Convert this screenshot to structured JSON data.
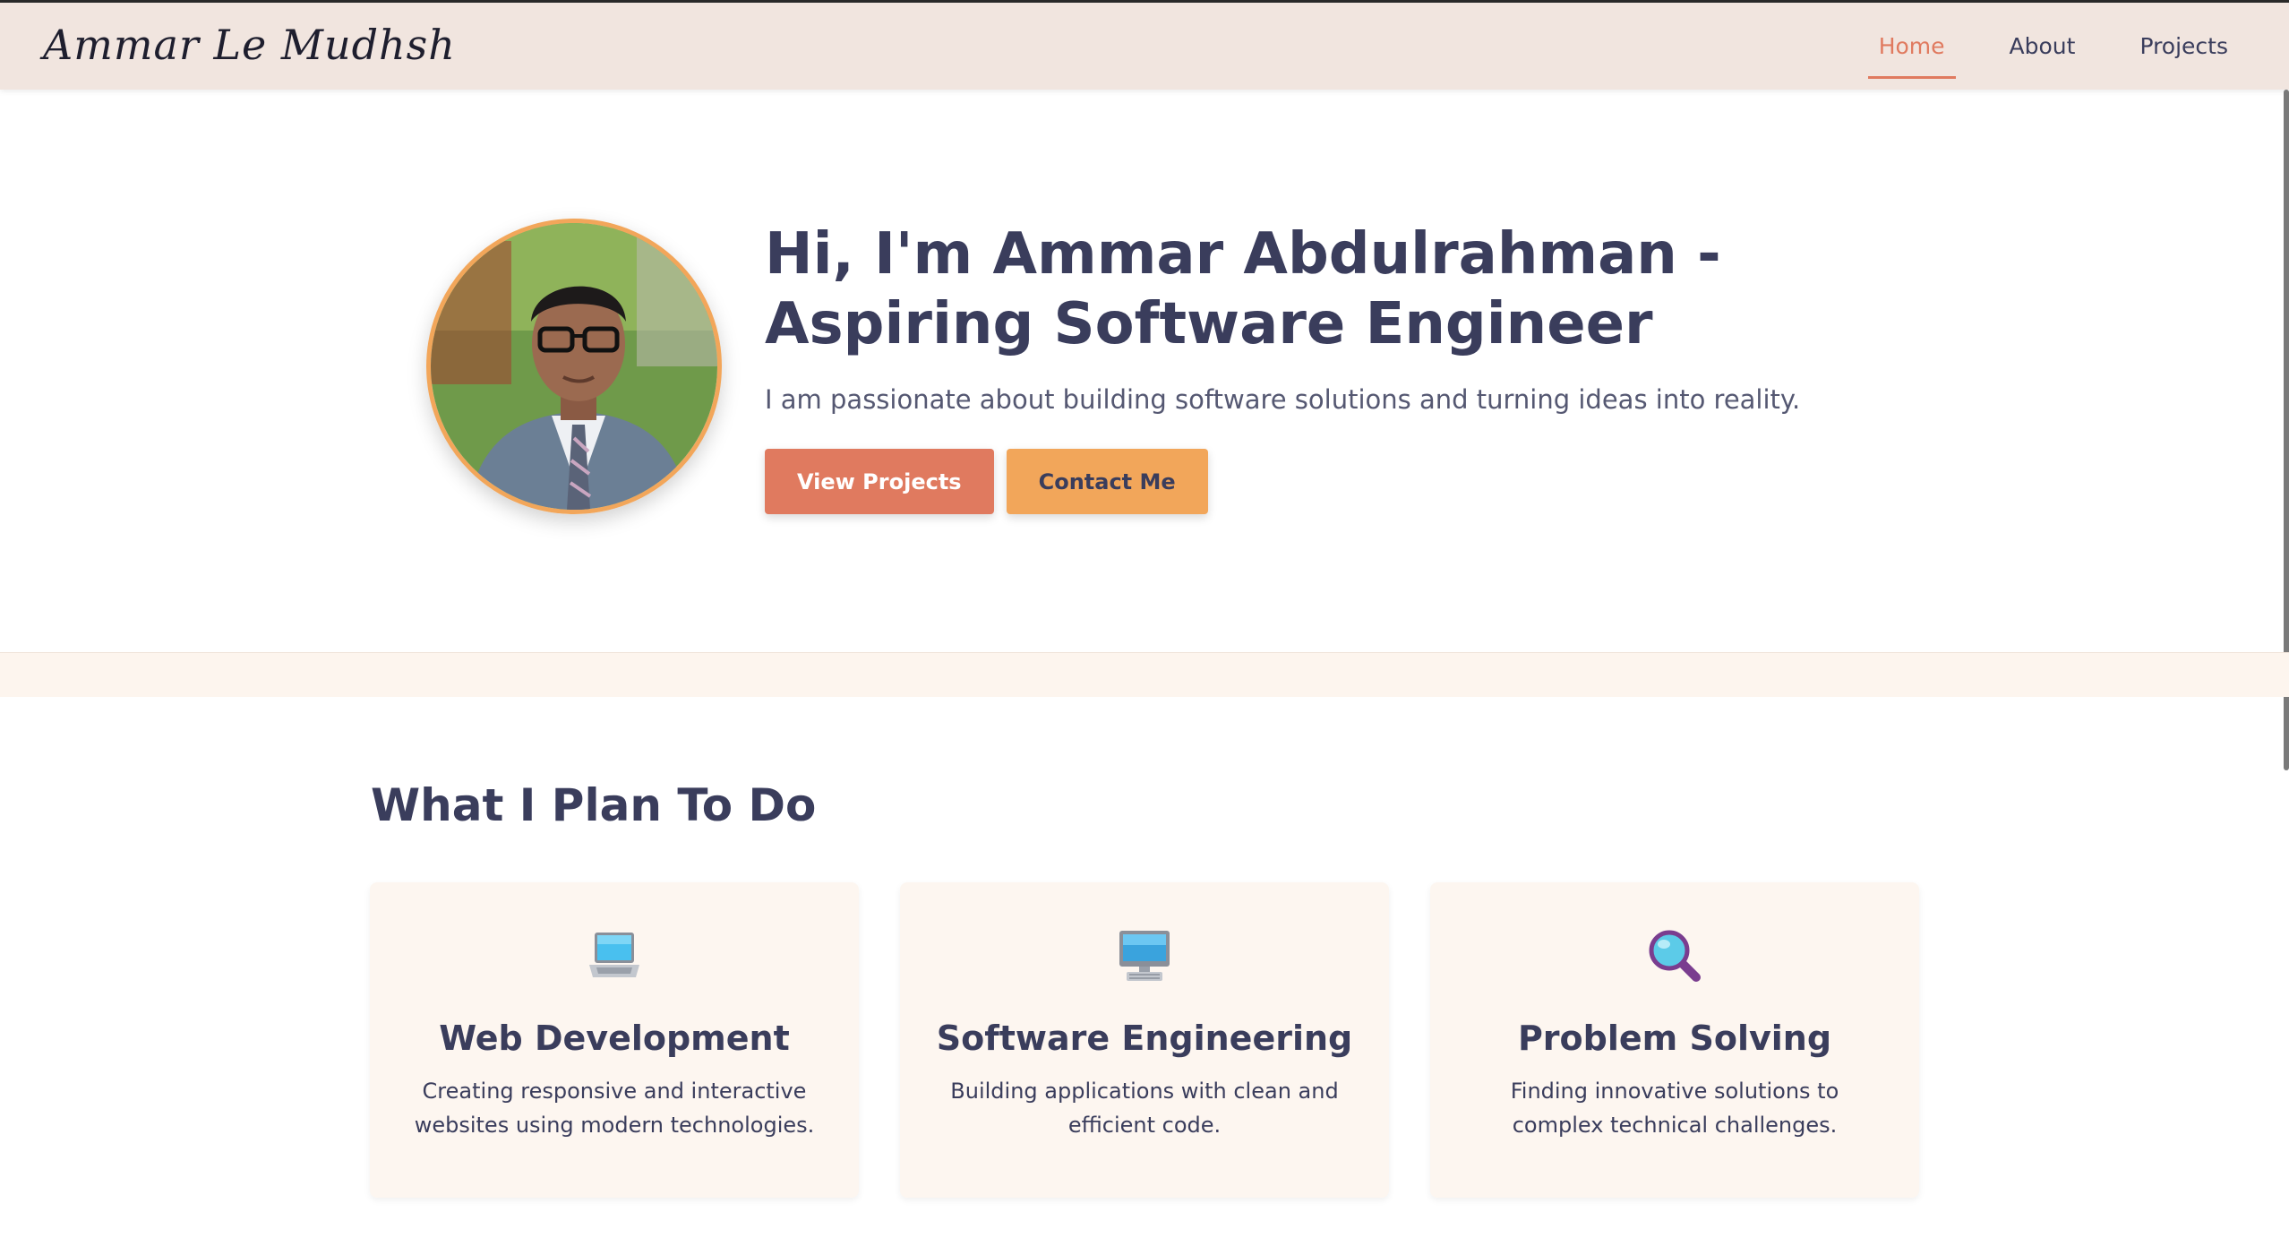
{
  "nav": {
    "logo": "Ammar Le Mudhsh",
    "links": [
      {
        "label": "Home",
        "active": true
      },
      {
        "label": "About",
        "active": false
      },
      {
        "label": "Projects",
        "active": false
      }
    ]
  },
  "hero": {
    "title": "Hi, I'm Ammar Abdulrahman - Aspiring Software Engineer",
    "subtitle": "I am passionate about building software solutions and turning ideas into reality.",
    "primary_button": "View Projects",
    "secondary_button": "Contact Me",
    "avatar": "profile-photo"
  },
  "plans": {
    "title": "What I Plan To Do",
    "cards": [
      {
        "icon": "laptop-icon",
        "title": "Web Development",
        "description": "Creating responsive and interactive websites using modern technologies."
      },
      {
        "icon": "desktop-computer-icon",
        "title": "Software Engineering",
        "description": "Building applications with clean and efficient code."
      },
      {
        "icon": "magnifying-glass-icon",
        "title": "Problem Solving",
        "description": "Finding innovative solutions to complex technical challenges."
      }
    ]
  },
  "colors": {
    "accent": "#e07a5f",
    "secondary": "#f2a65a",
    "navbar_bg": "#f1e5df",
    "heading": "#3a3d5c",
    "card_bg": "#fdf6f0"
  }
}
